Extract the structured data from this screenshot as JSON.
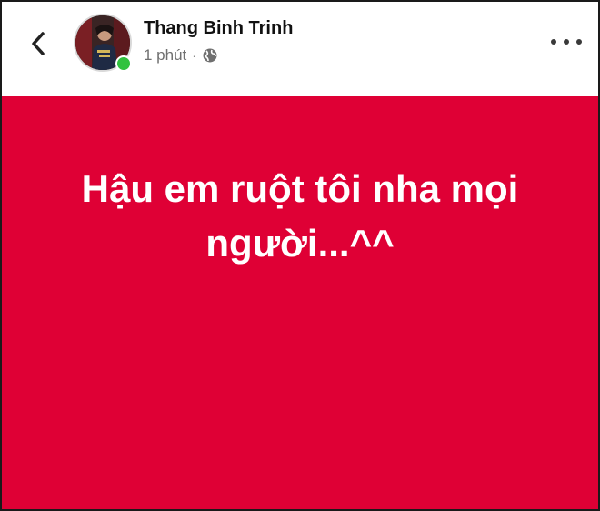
{
  "header": {
    "author_name": "Thang Binh Trinh",
    "timestamp": "1 phút",
    "separator": "·",
    "privacy_icon": "globe-icon",
    "back_icon": "chevron-left-icon",
    "more_icon": "more-dots-icon",
    "online_status": true
  },
  "post": {
    "text": "Hậu em ruột tôi nha mọi người...^^",
    "background_color": "#df0035",
    "text_color": "#ffffff"
  }
}
